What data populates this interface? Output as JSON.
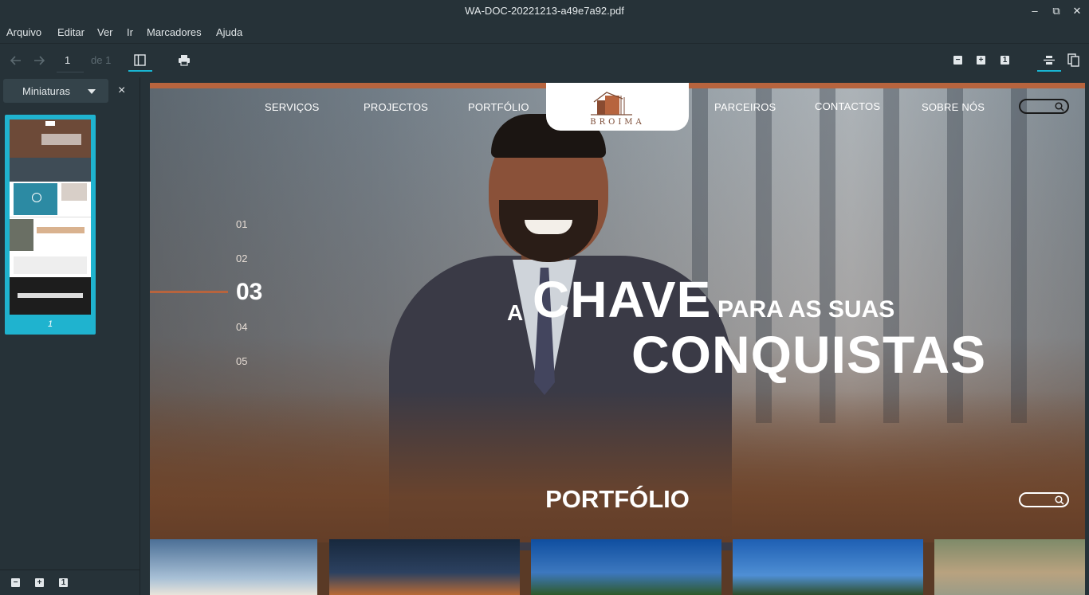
{
  "window": {
    "title": "WA-DOC-20221213-a49e7a92.pdf",
    "controls": {
      "minimize": "–",
      "restore": "⧉",
      "close": "✕"
    }
  },
  "menu": [
    "Arquivo",
    "Editar",
    "Ver",
    "Ir",
    "Marcadores",
    "Ajuda"
  ],
  "toolbar": {
    "page_current": "1",
    "page_of": "de 1"
  },
  "sidebar": {
    "dropdown_label": "Miniaturas",
    "close_glyph": "×",
    "thumbnail_page": "1"
  },
  "document": {
    "nav_left": [
      "SERVIÇOS",
      "PROJECTOS",
      "PORTFÓLIO"
    ],
    "nav_right": [
      "PARCEIROS",
      "CONTACTOS",
      "SOBRE NÓS"
    ],
    "logo_text": "BROIMA",
    "slides": [
      "01",
      "02",
      "03",
      "04",
      "05"
    ],
    "headline": {
      "a": "A",
      "chave": "CHAVE",
      "para": "PARA AS SUAS",
      "conquistas": "CONQUISTAS"
    },
    "section_title": "PORTFÓLIO"
  },
  "colors": {
    "accent": "#19b5d2",
    "brand": "#b7643e",
    "chrome_bg": "#263238"
  },
  "icons": {
    "back": "arrow-left-icon",
    "forward": "arrow-right-icon",
    "sidebar_toggle": "sidebar-icon",
    "print": "printer-icon",
    "zoom_out": "zoom-out-icon",
    "zoom_in": "zoom-in-icon",
    "zoom_reset": "zoom-original-icon",
    "continuous": "continuous-scroll-icon",
    "dual": "dual-page-icon",
    "search": "search-icon"
  }
}
